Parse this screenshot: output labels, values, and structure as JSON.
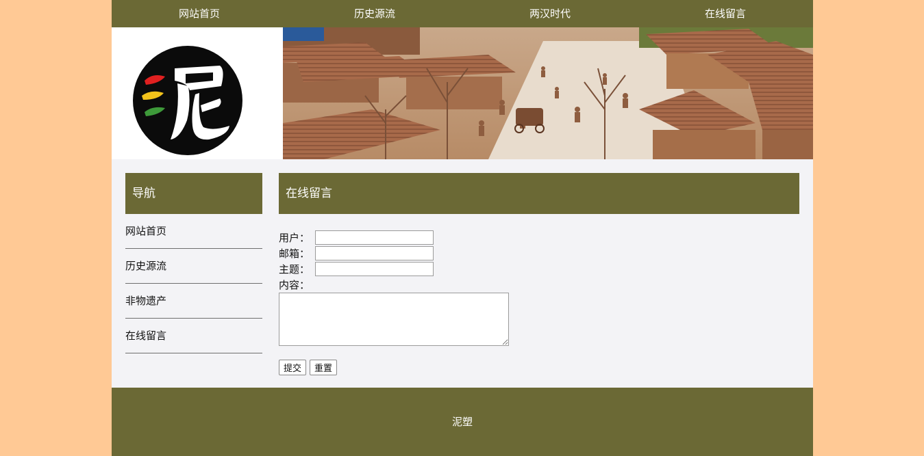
{
  "topnav": {
    "items": [
      {
        "label": "网站首页"
      },
      {
        "label": "历史源流"
      },
      {
        "label": "两汉时代"
      },
      {
        "label": "在线留言"
      }
    ]
  },
  "sidebar": {
    "title": "导航",
    "items": [
      {
        "label": "网站首页"
      },
      {
        "label": "历史源流"
      },
      {
        "label": "非物遗产"
      },
      {
        "label": "在线留言"
      }
    ]
  },
  "main": {
    "title": "在线留言",
    "form": {
      "user_label": "用户：",
      "user_value": "",
      "email_label": "邮箱：",
      "email_value": "",
      "subject_label": "主题：",
      "subject_value": "",
      "content_label": "内容：",
      "content_value": "",
      "submit_label": "提交",
      "reset_label": "重置"
    }
  },
  "footer": {
    "text": "泥塑"
  },
  "colors": {
    "accent": "#6b6935",
    "outer_background": "#ffc995",
    "content_background": "#f3f3f6"
  },
  "logo": {
    "glyph": "泥"
  }
}
